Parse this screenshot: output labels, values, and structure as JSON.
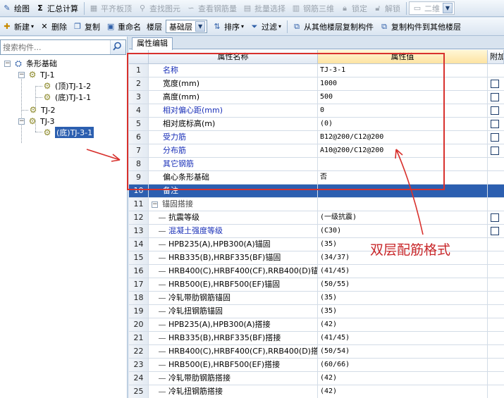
{
  "toolbar_main": {
    "items": [
      {
        "label": "绘图",
        "icon": "draw-icon",
        "enabled": true
      },
      {
        "label": "汇总计算",
        "icon": "sigma-icon",
        "enabled": true
      },
      {
        "label": "平齐板顶",
        "icon": "align-slab-icon",
        "enabled": false
      },
      {
        "label": "查找图元",
        "icon": "find-icon",
        "enabled": false
      },
      {
        "label": "查看钢筋量",
        "icon": "view-rebar-icon",
        "enabled": false
      },
      {
        "label": "批量选择",
        "icon": "batch-select-icon",
        "enabled": false
      },
      {
        "label": "钢筋三维",
        "icon": "rebar-3d-icon",
        "enabled": false
      },
      {
        "label": "锁定",
        "icon": "lock-icon",
        "enabled": false
      },
      {
        "label": "解锁",
        "icon": "unlock-icon",
        "enabled": false
      }
    ],
    "view_mode": "二维"
  },
  "toolbar_component": {
    "new_label": "新建",
    "delete_label": "删除",
    "copy_label": "复制",
    "rename_label": "重命名",
    "floor_label": "楼层",
    "floor_value": "基础层",
    "sort_label": "排序",
    "filter_label": "过滤",
    "copy_from_floor_label": "从其他楼层复制构件",
    "copy_to_floor_label": "复制构件到其他楼层"
  },
  "search": {
    "placeholder": "搜索构件..."
  },
  "tree": {
    "root": "条形基础",
    "nodes": [
      "TJ-1",
      "(顶)TJ-1-2",
      "(底)TJ-1-1",
      "TJ-2",
      "TJ-3",
      "(底)TJ-3-1"
    ]
  },
  "tab": {
    "label": "属性编辑"
  },
  "grid": {
    "header_name": "属性名称",
    "header_value": "属性值",
    "header_extra": "附加",
    "rows": [
      {
        "n": "1",
        "name": "名称",
        "value": "TJ-3-1",
        "blue": true,
        "checkbox": false
      },
      {
        "n": "2",
        "name": "宽度(mm)",
        "value": "1000",
        "blue": false,
        "checkbox": true
      },
      {
        "n": "3",
        "name": "高度(mm)",
        "value": "500",
        "blue": false,
        "checkbox": true
      },
      {
        "n": "4",
        "name": "相对偏心距(mm)",
        "value": "0",
        "blue": true,
        "checkbox": true
      },
      {
        "n": "5",
        "name": "相对底标高(m)",
        "value": "(0)",
        "blue": false,
        "checkbox": true
      },
      {
        "n": "6",
        "name": "受力筋",
        "value": "B12@200/C12@200",
        "blue": true,
        "checkbox": true
      },
      {
        "n": "7",
        "name": "分布筋",
        "value": "A10@200/C12@200",
        "blue": true,
        "checkbox": true
      },
      {
        "n": "8",
        "name": "其它钢筋",
        "value": "",
        "blue": true,
        "checkbox": false
      },
      {
        "n": "9",
        "name": "偏心条形基础",
        "value": "否",
        "blue": false,
        "checkbox": false
      },
      {
        "n": "10",
        "name": "备注",
        "value": "",
        "blue": false,
        "checkbox": false
      },
      {
        "n": "11",
        "name": "锚固搭接",
        "value": "",
        "blue": false,
        "checkbox": false
      },
      {
        "n": "12",
        "name": "抗震等级",
        "value": "(一级抗震)",
        "blue": false,
        "checkbox": true
      },
      {
        "n": "13",
        "name": "混凝土强度等级",
        "value": "(C30)",
        "blue": true,
        "checkbox": true
      },
      {
        "n": "14",
        "name": "HPB235(A),HPB300(A)锚固",
        "value": "(35)",
        "blue": false,
        "checkbox": false
      },
      {
        "n": "15",
        "name": "HRB335(B),HRBF335(BF)锚固",
        "value": "(34/37)",
        "blue": false,
        "checkbox": false
      },
      {
        "n": "16",
        "name": "HRB400(C),HRBF400(CF),RRB400(D)锚",
        "value": "(41/45)",
        "blue": false,
        "checkbox": false
      },
      {
        "n": "17",
        "name": "HRB500(E),HRBF500(EF)锚固",
        "value": "(50/55)",
        "blue": false,
        "checkbox": false
      },
      {
        "n": "18",
        "name": "冷轧带肋钢筋锚固",
        "value": "(35)",
        "blue": false,
        "checkbox": false
      },
      {
        "n": "19",
        "name": "冷轧扭钢筋锚固",
        "value": "(35)",
        "blue": false,
        "checkbox": false
      },
      {
        "n": "20",
        "name": "HPB235(A),HPB300(A)搭接",
        "value": "(42)",
        "blue": false,
        "checkbox": false
      },
      {
        "n": "21",
        "name": "HRB335(B),HRBF335(BF)搭接",
        "value": "(41/45)",
        "blue": false,
        "checkbox": false
      },
      {
        "n": "22",
        "name": "HRB400(C),HRBF400(CF),RRB400(D)搭",
        "value": "(50/54)",
        "blue": false,
        "checkbox": false
      },
      {
        "n": "23",
        "name": "HRB500(E),HRBF500(EF)搭接",
        "value": "(60/66)",
        "blue": false,
        "checkbox": false
      },
      {
        "n": "24",
        "name": "冷轧带肋钢筋搭接",
        "value": "(42)",
        "blue": false,
        "checkbox": false
      },
      {
        "n": "25",
        "name": "冷轧扭钢筋搭接",
        "value": "(42)",
        "blue": false,
        "checkbox": false
      }
    ]
  },
  "annotation": {
    "text": "双层配筋格式",
    "color": "#c8272a"
  },
  "colors": {
    "selection": "#2c5fb0",
    "highlight_box": "#d8312d",
    "blue_text": "#1a30b8"
  }
}
